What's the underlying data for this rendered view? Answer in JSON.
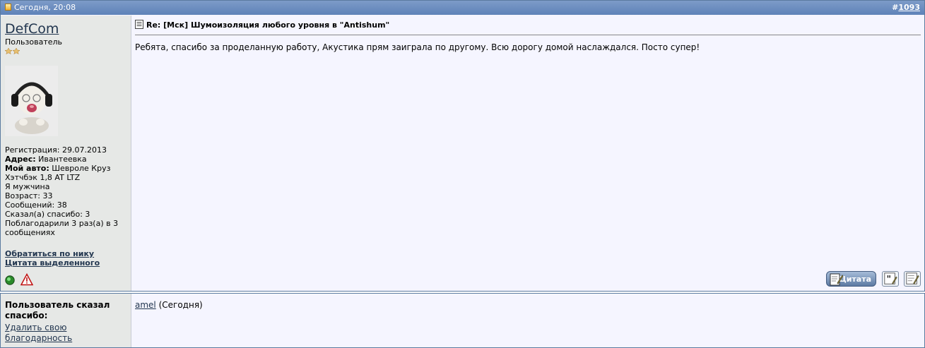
{
  "post": {
    "header_time": "Сегодня, 20:08",
    "post_number": "1093",
    "post_number_prefix": "#",
    "username": "DefCom",
    "user_title": "Пользователь",
    "title": "Re: [Мск] Шумоизоляция любого уровня в \"Antishum\"",
    "message": "Ребята, спасибо за проделанную работу, Акустика прям заиграла по другому. Всю дорогу домой наслаждался. Посто супер!",
    "info": {
      "registration": "Регистрация: 29.07.2013",
      "address_label": "Адрес:",
      "address_value": " Ивантеевка",
      "car_label": "Мой авто:",
      "car_value": " Шевроле Круз Хэтчбэк 1,8 AT LTZ",
      "gender": "Я мужчина",
      "age": "Возраст: 33",
      "messages": "Сообщений: 38",
      "said_thanks": "Сказал(а) спасибо: 3",
      "thanked": "Поблагодарили 3 раз(а) в 3 сообщениях"
    },
    "links": {
      "address_nick": "Обратиться по нику",
      "quote_selected": "Цитата выделенного"
    },
    "buttons": {
      "quote": "Цитата"
    }
  },
  "thanks": {
    "title": "Пользователь сказал спасибо:",
    "remove_link": "Удалить свою благодарность",
    "user": "amel",
    "when": " (Сегодня)"
  },
  "colors": {
    "header_bg": "#6a8cbf",
    "panel_bg": "#f5f5ff",
    "user_col_bg": "#e6e8e6",
    "link": "#22364f"
  }
}
